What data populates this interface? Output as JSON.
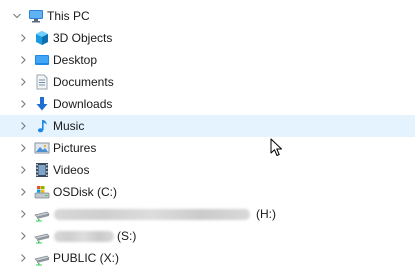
{
  "tree": {
    "root": {
      "label": "This PC",
      "icon": "this-pc-icon",
      "expanded": true
    },
    "items": [
      {
        "label": "3D Objects",
        "icon": "3d-objects-icon"
      },
      {
        "label": "Desktop",
        "icon": "desktop-folder-icon"
      },
      {
        "label": "Documents",
        "icon": "documents-icon"
      },
      {
        "label": "Downloads",
        "icon": "downloads-icon"
      },
      {
        "label": "Music",
        "icon": "music-icon",
        "hovered": true
      },
      {
        "label": "Pictures",
        "icon": "pictures-icon"
      },
      {
        "label": "Videos",
        "icon": "videos-icon"
      },
      {
        "label": "OSDisk (C:)",
        "icon": "system-drive-icon"
      },
      {
        "label": "(H:)",
        "icon": "network-drive-icon",
        "name_redacted": true
      },
      {
        "label": "(S:)",
        "icon": "network-drive-icon",
        "name_redacted": true
      },
      {
        "label": "PUBLIC (X:)",
        "icon": "network-drive-icon"
      }
    ]
  },
  "colors": {
    "hover_background": "#e5f3ff",
    "chevron": "#8a8a8a",
    "folder_blue": "#1e88e5"
  }
}
